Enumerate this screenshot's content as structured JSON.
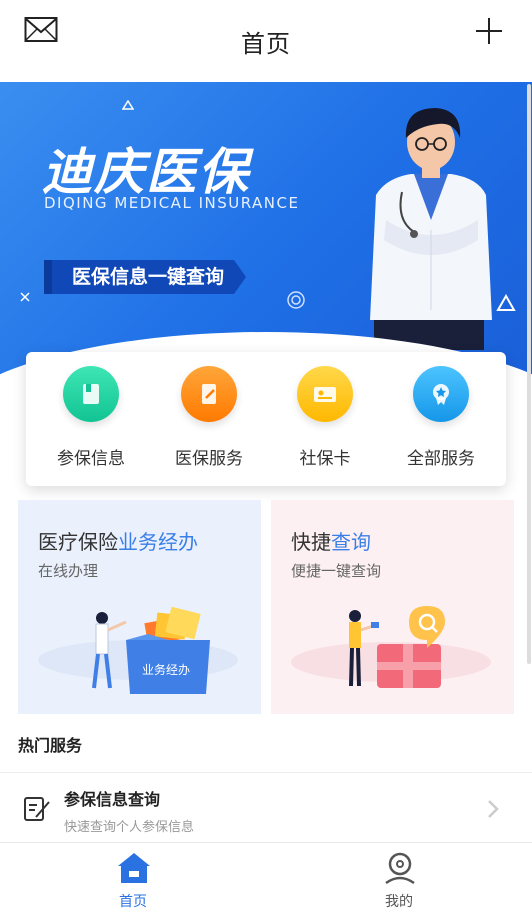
{
  "header": {
    "title": "首页"
  },
  "banner": {
    "brand": "迪庆医保",
    "brand_en": "DIQING MEDICAL INSURANCE",
    "slogan": "医保信息一键查询"
  },
  "quick_services": [
    {
      "label": "参保信息",
      "icon": "book-icon",
      "color": "#1dcf9e"
    },
    {
      "label": "医保服务",
      "icon": "edit-doc-icon",
      "color": "#ff8a12"
    },
    {
      "label": "社保卡",
      "icon": "id-card-icon",
      "color": "#ffc21a"
    },
    {
      "label": "全部服务",
      "icon": "badge-icon",
      "color": "#26a9f2"
    }
  ],
  "cards": {
    "business": {
      "title_prefix": "医疗保险",
      "title_highlight": "业务经办",
      "subtitle": "在线办理",
      "art_label": "业务经办"
    },
    "query": {
      "title_prefix": "快捷",
      "title_highlight": "查询",
      "subtitle": "便捷一键查询"
    }
  },
  "hot": {
    "title": "热门服务",
    "items": [
      {
        "name": "参保信息查询",
        "desc": "快速查询个人参保信息"
      }
    ]
  },
  "tabbar": [
    {
      "label": "首页",
      "active": true
    },
    {
      "label": "我的",
      "active": false
    }
  ],
  "colors": {
    "accent": "#2a72e2",
    "banner": "#2a7be9"
  }
}
